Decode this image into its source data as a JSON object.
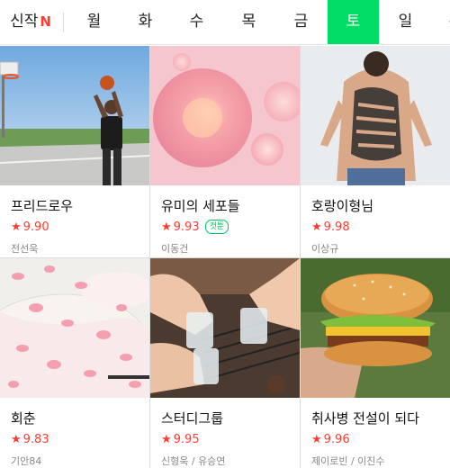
{
  "tabs": {
    "new_label": "신작",
    "new_badge": "N",
    "days": [
      "월",
      "화",
      "수",
      "목",
      "금",
      "토",
      "일",
      "완"
    ]
  },
  "cards": [
    {
      "title": "프리드로우",
      "rating": "9.90",
      "author": "전선욱",
      "badge": ""
    },
    {
      "title": "유미의 세포들",
      "rating": "9.93",
      "author": "이동건",
      "badge": "컷툰"
    },
    {
      "title": "호랑이형님",
      "rating": "9.98",
      "author": "이상규",
      "badge": ""
    },
    {
      "title": "회춘",
      "rating": "9.83",
      "author": "기안84",
      "badge": ""
    },
    {
      "title": "스터디그룹",
      "rating": "9.95",
      "author": "신형욱 / 유승연",
      "badge": ""
    },
    {
      "title": "취사병 전설이 되다",
      "rating": "9.96",
      "author": "제이로빈 / 이진수",
      "badge": ""
    }
  ],
  "icons": {
    "star": "★"
  },
  "colors": {
    "accent": "#00dc64",
    "rating": "#ff3b2f",
    "badge": "#00c35a"
  }
}
